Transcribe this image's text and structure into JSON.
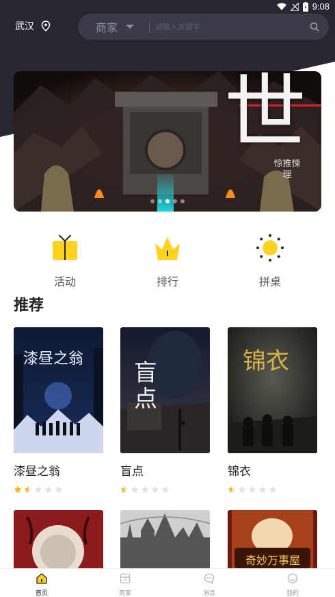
{
  "status_bar": {
    "time": "9:08",
    "icons": [
      "wifi-icon",
      "signal-icon",
      "battery-icon"
    ]
  },
  "header": {
    "city": "武汉",
    "search": {
      "category": "商家",
      "placeholder": "请输入关键字"
    }
  },
  "banner": {
    "title": "世",
    "subtitle": "惊推悚理",
    "slide_count": 5,
    "active_index": 2
  },
  "quick_nav": [
    {
      "label": "活动",
      "icon": "gift-icon"
    },
    {
      "label": "排行",
      "icon": "crown-icon"
    },
    {
      "label": "拼桌",
      "icon": "sun-icon"
    }
  ],
  "section_title": "推荐",
  "recommend": [
    {
      "title": "漆昼之翁",
      "rating": 1.5,
      "poster_text": "漆昼之翁"
    },
    {
      "title": "盲点",
      "rating": 0.5,
      "poster_text": "盲点"
    },
    {
      "title": "锦衣",
      "rating": 0.5,
      "poster_text": "锦衣"
    }
  ],
  "recommend_row2": [
    {
      "poster_text": ""
    },
    {
      "poster_text": ""
    },
    {
      "poster_text": "奇妙万事屋"
    }
  ],
  "tab_bar": [
    {
      "label": "首页",
      "icon": "home-icon",
      "active": true
    },
    {
      "label": "商家",
      "icon": "shop-icon",
      "active": false
    },
    {
      "label": "消息",
      "icon": "message-icon",
      "active": false
    },
    {
      "label": "我的",
      "icon": "profile-icon",
      "active": false
    }
  ],
  "colors": {
    "accent": "#ffd21f",
    "header_bg": "#262731",
    "star_on": "#f7b500",
    "star_off": "#e2e2e2"
  }
}
